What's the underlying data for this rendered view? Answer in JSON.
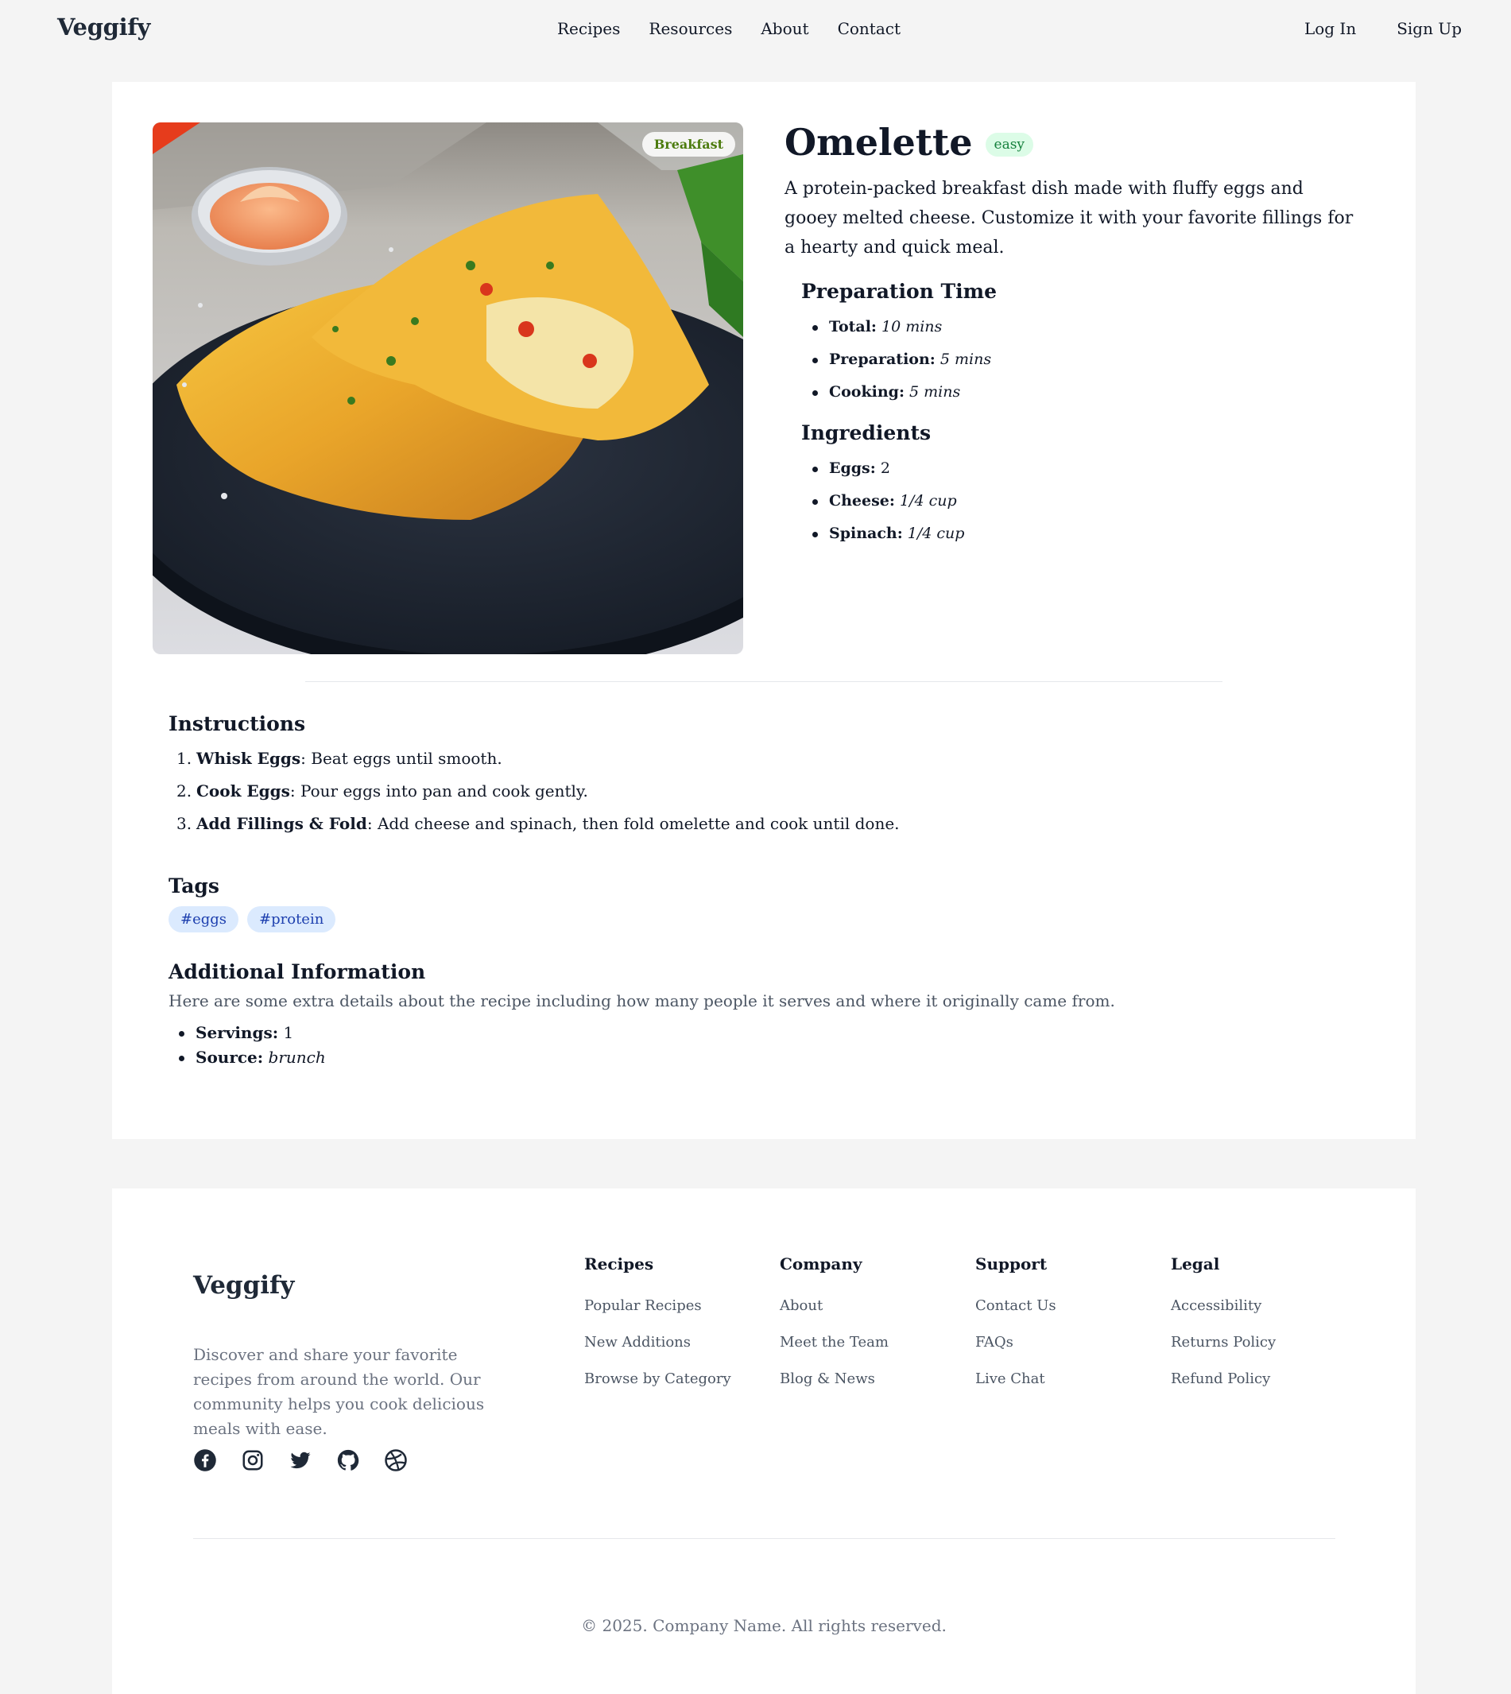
{
  "header": {
    "logo": "Veggify",
    "nav": [
      "Recipes",
      "Resources",
      "About",
      "Contact"
    ],
    "login": "Log In",
    "signup": "Sign Up"
  },
  "recipe": {
    "category": "Breakfast",
    "title": "Omelette",
    "difficulty": "easy",
    "description": "A protein-packed breakfast dish made with fluffy eggs and gooey melted cheese. Customize it with your favorite fillings for a hearty and quick meal.",
    "prep_heading": "Preparation Time",
    "prep": [
      {
        "label": "Total:",
        "value": "10 mins"
      },
      {
        "label": "Preparation:",
        "value": "5 mins"
      },
      {
        "label": "Cooking:",
        "value": "5 mins"
      }
    ],
    "ingredients_heading": "Ingredients",
    "ingredients": [
      {
        "label": "Eggs:",
        "value": "2"
      },
      {
        "label": "Cheese:",
        "value": "1/4 cup"
      },
      {
        "label": "Spinach:",
        "value": "1/4 cup"
      }
    ],
    "instructions_heading": "Instructions",
    "instructions": [
      {
        "num": "1.",
        "title": "Whisk Eggs",
        "text": ": Beat eggs until smooth."
      },
      {
        "num": "2.",
        "title": "Cook Eggs",
        "text": ": Pour eggs into pan and cook gently."
      },
      {
        "num": "3.",
        "title": "Add Fillings & Fold",
        "text": ": Add cheese and spinach, then fold omelette and cook until done."
      }
    ],
    "tags_heading": "Tags",
    "tags": [
      "#eggs",
      "#protein"
    ],
    "additional_heading": "Additional Information",
    "additional_text": "Here are some extra details about the recipe including how many people it serves and where it originally came from.",
    "additional": [
      {
        "label": "Servings:",
        "value": "1",
        "italic": false
      },
      {
        "label": "Source:",
        "value": "brunch",
        "italic": true
      }
    ]
  },
  "footer": {
    "logo": "Veggify",
    "description": "Discover and share your favorite recipes from around the world. Our community helps you cook delicious meals with ease.",
    "socials": [
      "facebook-icon",
      "instagram-icon",
      "twitter-icon",
      "github-icon",
      "dribbble-icon"
    ],
    "columns": [
      {
        "heading": "Recipes",
        "links": [
          "Popular Recipes",
          "New Additions",
          "Browse by Category"
        ]
      },
      {
        "heading": "Company",
        "links": [
          "About",
          "Meet the Team",
          "Blog & News"
        ]
      },
      {
        "heading": "Support",
        "links": [
          "Contact Us",
          "FAQs",
          "Live Chat"
        ]
      },
      {
        "heading": "Legal",
        "links": [
          "Accessibility",
          "Returns Policy",
          "Refund Policy"
        ]
      }
    ],
    "copyright": "© 2025. Company Name. All rights reserved."
  },
  "colors": {
    "page_bg": "#f4f4f4",
    "card_bg": "#ffffff",
    "difficulty_bg": "#dcfce7",
    "difficulty_text": "#15803d",
    "tag_bg": "#dbeafe",
    "tag_text": "#1e40af",
    "category_text": "#4d7c0f"
  }
}
